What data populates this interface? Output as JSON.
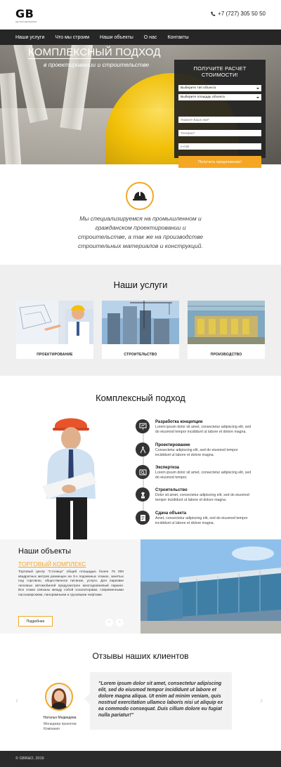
{
  "header": {
    "logo": "GB",
    "logo_sub": "проектирование",
    "phone": "+7 (727) 305 50 50"
  },
  "nav": [
    "Наши услуги",
    "Что мы строим",
    "Наши объекты",
    "О нас",
    "Контакты"
  ],
  "hero": {
    "title": "КОМПЛЕКСНЫЙ ПОДХОД",
    "subtitle": "в проектировании и строительстве"
  },
  "form": {
    "title": "ПОЛУЧИТЕ РАСЧЕТ СТОИМОСТИ!",
    "select_type": "Выберите тип объекта",
    "select_area": "Выберите площадь объекта",
    "name_placeholder": "Укажите Ваше имя*",
    "phone_placeholder": "Телефон*",
    "email_placeholder": "e-mail",
    "submit": "Получить предложение!"
  },
  "intro": {
    "text": "Мы специализируемся на промышленном и гражданском проектировании и строительстве, а так же на производстве строительных материалов и конструкций."
  },
  "services": {
    "title": "Наши услуги",
    "items": [
      {
        "label": "ПРОЕКТИРОВАНИЕ"
      },
      {
        "label": "СТРОИТЕЛЬСТВО"
      },
      {
        "label": "ПРОИЗВОДСТВО"
      }
    ]
  },
  "approach": {
    "title": "Комплексный подход",
    "steps": [
      {
        "title": "Разработка концепции",
        "text": "Lorem ipsum dolor sit amet, consectetur adipiscing elit, sed do eiusmod tempor incididunt ut labore et dolore magna."
      },
      {
        "title": "Проектирование",
        "text": "Consectetur adipiscing elit, sed do eiusmod tempor incididunt ut labore et dolore magna."
      },
      {
        "title": "Экспертиза",
        "text": "Lorem ipsum dolor sit amet, consectetur adipiscing elit, sed do eiusmod tempor."
      },
      {
        "title": "Строительство",
        "text": "Dolor sit amet, consectetur adipiscing elit, sed do eiusmod tempor incididunt ut labore et dolore magna."
      },
      {
        "title": "Сдача объекта",
        "text": "Amet, consectetur adipiscing elit, sed do eiusmod tempor incididunt ut labore et dolore magna."
      }
    ]
  },
  "objects": {
    "title": "Наши объекты",
    "subtitle": "ТОРГОВЫЙ КОМПЛЕКС",
    "text": "Торговый центр \"Столица\" общей площадью более 75 000 квадратных метров размещен на 3-х подземных этажах, занятых под торговлю, общественное питание, услуги. Для парковки легковых автомобилей предусмотрен многоуровневый паркинг. Все этажи связаны между собой эскалаторами, современными пассажирскими, панорамными и грузовыми лифтами.",
    "button": "Подробнее",
    "prev": "‹",
    "next": "›"
  },
  "reviews": {
    "title": "Отзывы наших клиентов",
    "name": "Наталья Медведева",
    "role_line1": "Менеджер проектов",
    "role_line2": "Компания",
    "quote": "\"Lorem ipsum dolor sit amet, consectetur adipiscing elit, sed do eiusmod tempor incididunt ut labore et dolore magna aliqua. Ut enim ad minim veniam, quis nostrud exercitation ullamco laboris nisi ut aliquip ex ea commodo consequat. Duis cillum dolore eu fugiat nulla pariatur!\"",
    "prev": "‹",
    "next": "›"
  },
  "footer": {
    "copyright": "© GBR&O, 2016"
  },
  "colors": {
    "accent": "#f5a623",
    "dark": "#262626"
  }
}
